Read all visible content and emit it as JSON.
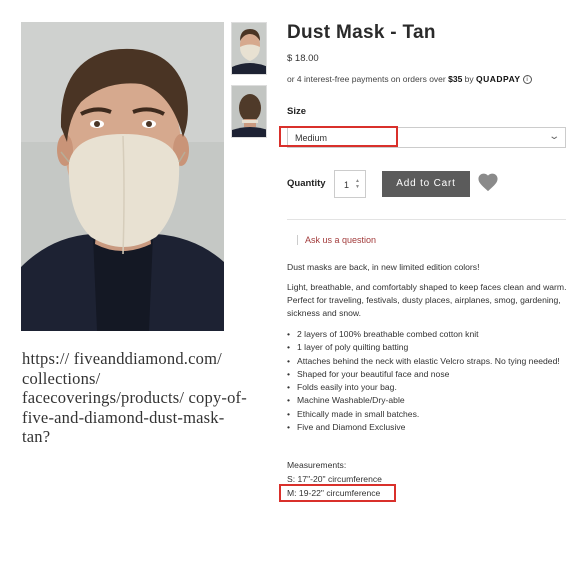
{
  "product": {
    "title": "Dust Mask - Tan",
    "price": "$ 18.00",
    "installments_prefix": "or 4 interest-free payments on orders over ",
    "installments_amount": "$35",
    "installments_by": " by ",
    "provider": "QUADPAY",
    "info_icon": "ⓘ"
  },
  "gallery": {
    "main_image": "man-wearing-tan-dust-mask",
    "thumbnails": [
      "front-view-thumbnail",
      "back-view-thumbnail"
    ]
  },
  "size": {
    "label": "Size",
    "selected": "Medium"
  },
  "quantity": {
    "label": "Quantity",
    "value": "1",
    "add_to_cart": "Add to Cart"
  },
  "ask": "Ask us a question",
  "description": {
    "line1": "Dust masks are back, in new limited edition colors!",
    "line2": "Light, breathable, and comfortably shaped to keep faces clean and warm. Perfect for traveling, festivals, dusty places, airplanes, smog, gardening, sickness and snow.",
    "features": [
      "2 layers of 100% breathable combed cotton knit",
      "1 layer of poly quilting batting",
      "Attaches behind the neck with elastic Velcro straps. No tying needed!",
      "Shaped for your beautiful face and nose",
      "Folds easily into your bag.",
      "Machine Washable/Dry-able",
      "Ethically made in small batches.",
      "Five and Diamond Exclusive"
    ]
  },
  "measurements": {
    "heading": "Measurements:",
    "small": "S: 17\"-20\" circumference",
    "medium": "M: 19-22\" circumference"
  },
  "source_url": "https:// fiveanddiamond.com/ collections/ facecoverings/products/ copy-of-five-and-diamond-dust-mask-tan?",
  "colors": {
    "highlight": "#d9302b",
    "button": "#5b5b5b",
    "link": "#a23b3b",
    "mask": "#e8e1d2"
  }
}
